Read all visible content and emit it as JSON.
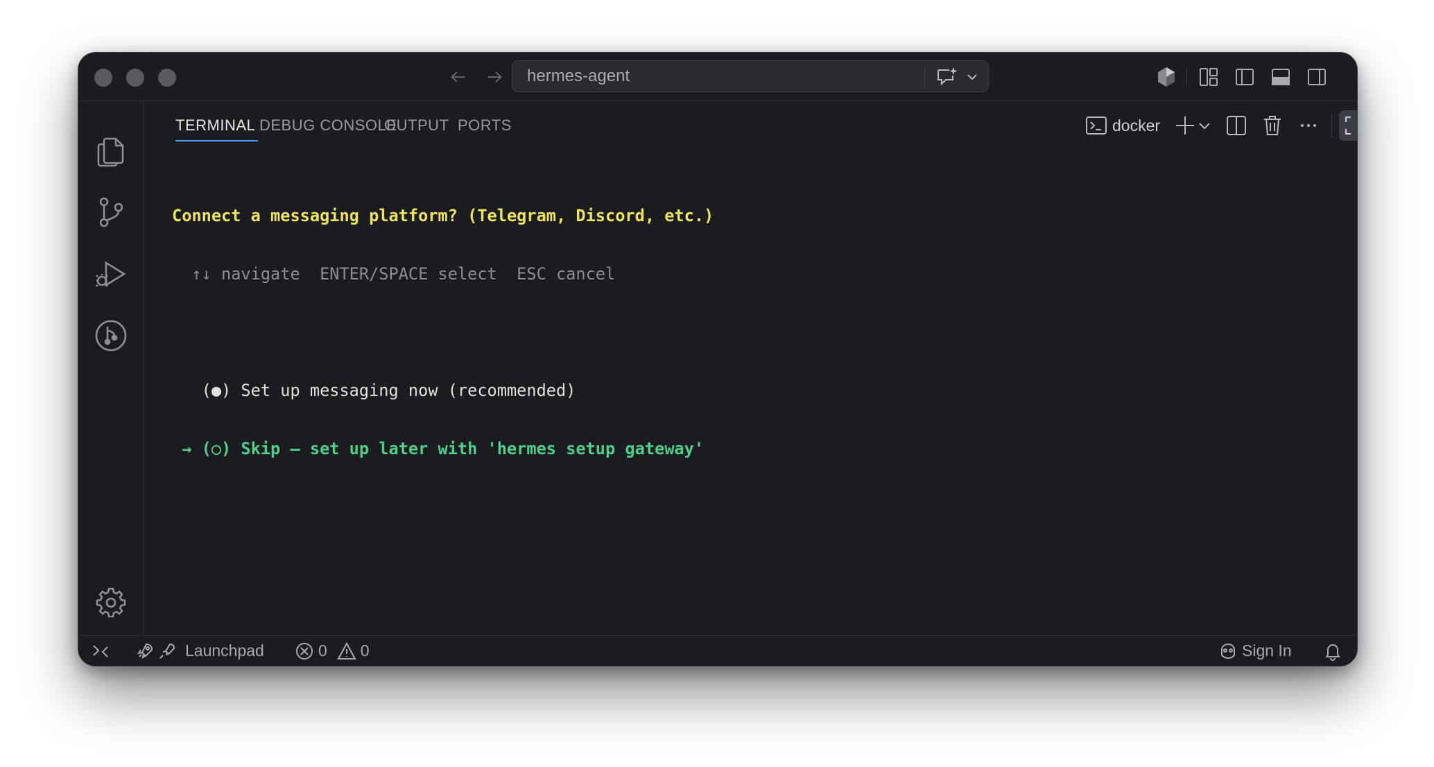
{
  "titlebar": {
    "search_label": "hermes-agent"
  },
  "panel": {
    "tabs": [
      {
        "label": "TERMINAL",
        "active": true
      },
      {
        "label": "DEBUG CONSOLE",
        "active": false
      },
      {
        "label": "OUTPUT",
        "active": false
      },
      {
        "label": "PORTS",
        "active": false
      }
    ],
    "terminal_profile": "docker"
  },
  "terminal": {
    "lines": [
      {
        "text": "Connect a messaging platform? (Telegram, Discord, etc.)",
        "style": "yellow"
      },
      {
        "text": "  ↑↓ navigate  ENTER/SPACE select  ESC cancel",
        "style": "dim"
      },
      {
        "text": "",
        "style": "dim"
      },
      {
        "text": "   (●) Set up messaging now (recommended)",
        "style": "white"
      },
      {
        "text": " → (○) Skip — set up later with 'hermes setup gateway'",
        "style": "green"
      }
    ]
  },
  "statusbar": {
    "launchpad_label": "Launchpad",
    "errors": "0",
    "warnings": "0",
    "sign_in_label": "Sign In"
  },
  "colors": {
    "background": "#1b1c1f",
    "prompt_yellow": "#f0e35c",
    "selected_green": "#4fd08a",
    "accent_blue": "#4a9eff"
  }
}
